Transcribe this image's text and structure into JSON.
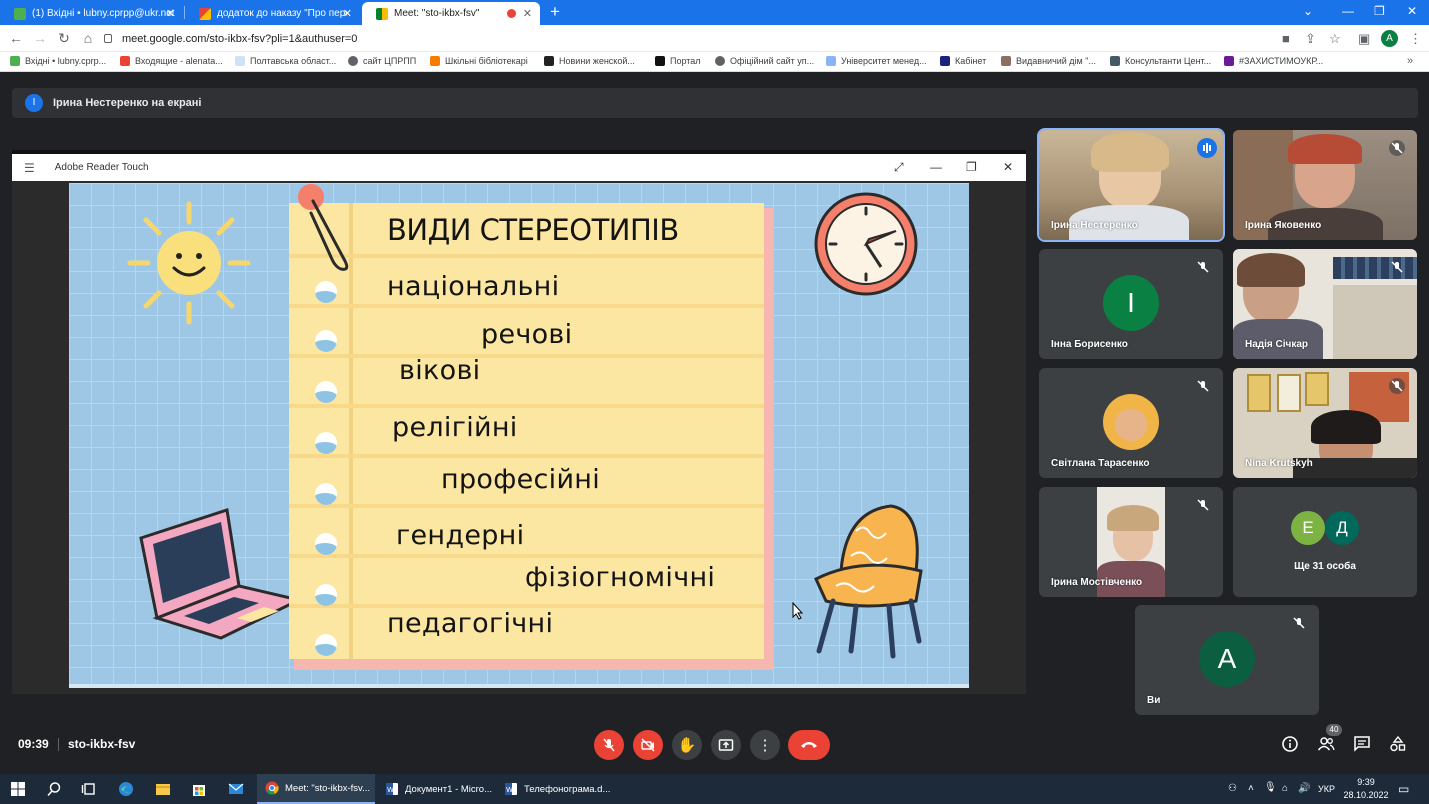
{
  "browser": {
    "tabs": [
      {
        "title": "(1) Вхідні • lubny.cprpp@ukr.net",
        "active": false
      },
      {
        "title": "додаток до наказу \"Про переро",
        "active": false
      },
      {
        "title": "Meet: \"sto-ikbx-fsv\"",
        "active": true
      }
    ],
    "url": "meet.google.com/sto-ikbx-fsv?pli=1&authuser=0",
    "profile_initial": "A",
    "bookmarks": [
      "Вхідні • lubny.cprp...",
      "Входящие - alenata...",
      "Полтавська област...",
      "сайт ЦПРПП",
      "Шкільні бібліотекарі",
      "Новини женской...",
      "Портал",
      "Офіційний сайт уп...",
      "Університет менед...",
      "Кабінет",
      "Видавничий дім \"...",
      "Консультанти Цент...",
      "#ЗАХИСТИМОУКР..."
    ]
  },
  "meet": {
    "presenter_initial": "І",
    "presenter_banner": "Ірина Нестеренко на екрані",
    "shared_window_title": "Adobe Reader Touch",
    "slide": {
      "title": "ВИДИ СТЕРЕОТИПІВ",
      "items": [
        "національні",
        "речові",
        "вікові",
        "релігійні",
        "професійні",
        "гендерні",
        "фізіогномічні",
        "педагогічні"
      ]
    },
    "participants": [
      {
        "name": "Ірина Нестеренко",
        "speaking": true
      },
      {
        "name": "Ірина Яковенко",
        "muted": true
      },
      {
        "name": "Інна Борисенко",
        "initial": "І",
        "avatar_color": "#0b8043",
        "muted": true
      },
      {
        "name": "Надія Січкар",
        "muted": true
      },
      {
        "name": "Світлана Тарасенко",
        "muted": true
      },
      {
        "name": "Nina Krutskyh",
        "muted": true
      },
      {
        "name": "Ірина Мостівченко",
        "muted": true
      },
      {
        "name": "Ще 31 особа",
        "initials": [
          "Е",
          "Д"
        ]
      },
      {
        "name": "Ви",
        "initial": "A",
        "avatar_color": "#0b5e3f",
        "muted": true
      }
    ],
    "time": "09:39",
    "meeting_code": "sto-ikbx-fsv",
    "people_count": "40"
  },
  "taskbar": {
    "apps": [
      {
        "label": "Meet: \"sto-ikbx-fsv...",
        "active": true
      },
      {
        "label": "Документ1 - Micro...",
        "active": false
      },
      {
        "label": "Телефонограма.d...",
        "active": false
      }
    ],
    "language": "УКР",
    "time": "9:39",
    "date": "28.10.2022"
  }
}
